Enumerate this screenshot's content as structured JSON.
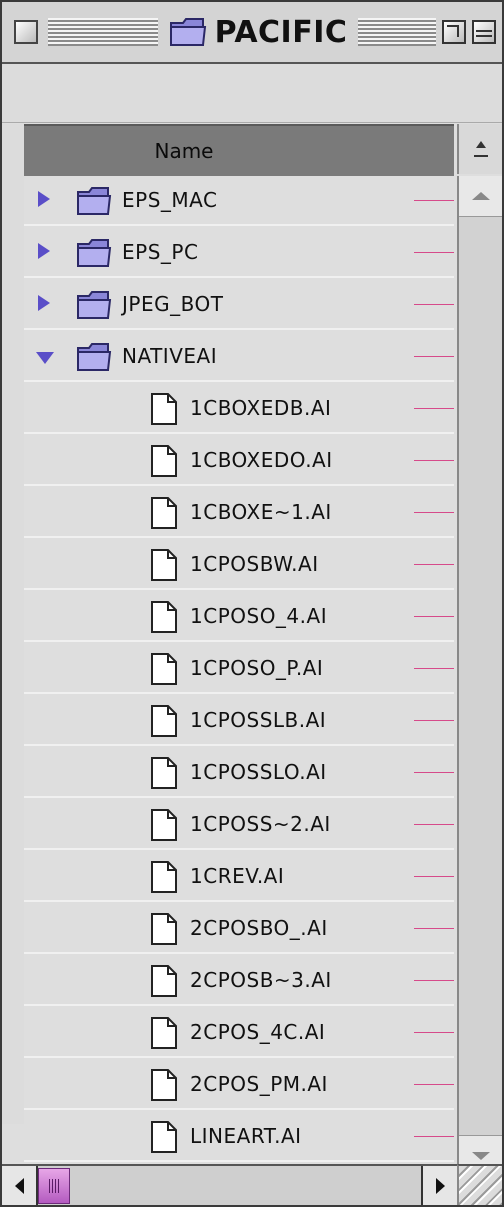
{
  "window": {
    "title": "PACIFIC"
  },
  "columns": {
    "name_header": "Name"
  },
  "items": [
    {
      "name": "EPS_MAC",
      "kind": "folder",
      "disclosure": "collapsed",
      "level": 0
    },
    {
      "name": "EPS_PC",
      "kind": "folder",
      "disclosure": "collapsed",
      "level": 0
    },
    {
      "name": "JPEG_BOT",
      "kind": "folder",
      "disclosure": "collapsed",
      "level": 0
    },
    {
      "name": "NATIVEAI",
      "kind": "folder",
      "disclosure": "expanded",
      "level": 0
    },
    {
      "name": "1CBOXEDB.AI",
      "kind": "file",
      "level": 1
    },
    {
      "name": "1CBOXEDO.AI",
      "kind": "file",
      "level": 1
    },
    {
      "name": "1CBOXE~1.AI",
      "kind": "file",
      "level": 1
    },
    {
      "name": "1CPOSBW.AI",
      "kind": "file",
      "level": 1
    },
    {
      "name": "1CPOSO_4.AI",
      "kind": "file",
      "level": 1
    },
    {
      "name": "1CPOSO_P.AI",
      "kind": "file",
      "level": 1
    },
    {
      "name": "1CPOSSLB.AI",
      "kind": "file",
      "level": 1
    },
    {
      "name": "1CPOSSLO.AI",
      "kind": "file",
      "level": 1
    },
    {
      "name": "1CPOSS~2.AI",
      "kind": "file",
      "level": 1
    },
    {
      "name": "1CREV.AI",
      "kind": "file",
      "level": 1
    },
    {
      "name": "2CPOSBO_.AI",
      "kind": "file",
      "level": 1
    },
    {
      "name": "2CPOSB~3.AI",
      "kind": "file",
      "level": 1
    },
    {
      "name": "2CPOS_4C.AI",
      "kind": "file",
      "level": 1
    },
    {
      "name": "2CPOS_PM.AI",
      "kind": "file",
      "level": 1
    },
    {
      "name": "LINEART.AI",
      "kind": "file",
      "level": 1
    }
  ],
  "colors": {
    "disclosure": "#5a4ec8",
    "folder": "#8a86d8",
    "callout": "#d64a8a",
    "scroll_thumb": "#c57ad0"
  },
  "icons": {
    "close": "close-box-icon",
    "zoom": "zoom-box-icon",
    "collapse": "collapse-box-icon",
    "folder": "folder-icon",
    "file": "document-icon",
    "sort": "sort-direction-icon"
  }
}
